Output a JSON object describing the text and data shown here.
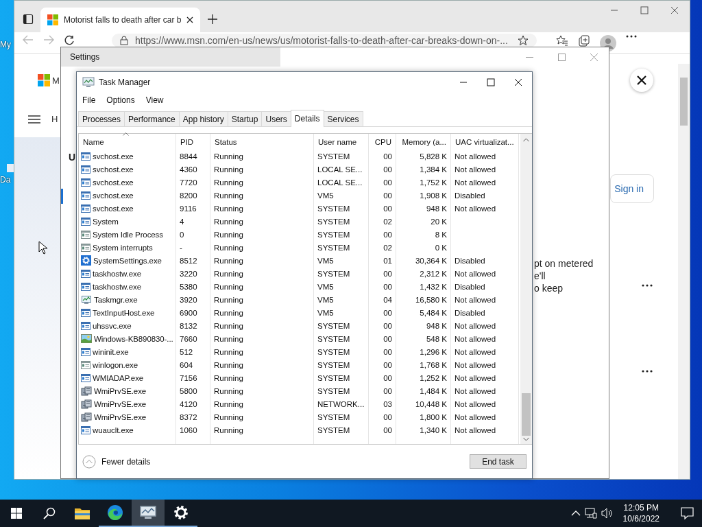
{
  "desktop": {
    "icons": [
      {
        "label": "My"
      },
      {
        "label": "Da"
      }
    ]
  },
  "browser": {
    "tab_title": "Motorist falls to death after car b",
    "address": "https://www.msn.com/en-us/news/us/motorist-falls-to-death-after-car-breaks-down-on-...",
    "page": {
      "logo_text": "M",
      "nav_text": "H",
      "sign_in": "Sign in"
    }
  },
  "settings": {
    "title": "Settings",
    "heading_fragment": "U",
    "text_lines": [
      "pt on metered",
      "e'll",
      "o keep"
    ]
  },
  "task_manager": {
    "title": "Task Manager",
    "menu": [
      "File",
      "Options",
      "View"
    ],
    "tabs": [
      {
        "label": "Processes",
        "selected": false
      },
      {
        "label": "Performance",
        "selected": false
      },
      {
        "label": "App history",
        "selected": false
      },
      {
        "label": "Startup",
        "selected": false
      },
      {
        "label": "Users",
        "selected": false
      },
      {
        "label": "Details",
        "selected": true
      },
      {
        "label": "Services",
        "selected": false
      }
    ],
    "columns": [
      {
        "label": "Name",
        "sorted": true
      },
      {
        "label": "PID",
        "sorted": false
      },
      {
        "label": "Status",
        "sorted": false
      },
      {
        "label": "User name",
        "sorted": false
      },
      {
        "label": "CPU",
        "sorted": false
      },
      {
        "label": "Memory (a...",
        "sorted": false
      },
      {
        "label": "UAC virtualizat...",
        "sorted": false
      }
    ],
    "rows": [
      {
        "kind": "service",
        "cells": [
          "svchost.exe",
          "8844",
          "Running",
          "SYSTEM",
          "00",
          "5,828 K",
          "Not allowed"
        ]
      },
      {
        "kind": "service",
        "cells": [
          "svchost.exe",
          "4360",
          "Running",
          "LOCAL SE...",
          "00",
          "1,384 K",
          "Not allowed"
        ]
      },
      {
        "kind": "service",
        "cells": [
          "svchost.exe",
          "7720",
          "Running",
          "LOCAL SE...",
          "00",
          "1,752 K",
          "Not allowed"
        ]
      },
      {
        "kind": "service",
        "cells": [
          "svchost.exe",
          "8200",
          "Running",
          "VM5",
          "00",
          "1,908 K",
          "Disabled"
        ]
      },
      {
        "kind": "service",
        "cells": [
          "svchost.exe",
          "9116",
          "Running",
          "SYSTEM",
          "00",
          "948 K",
          "Not allowed"
        ]
      },
      {
        "kind": "service",
        "cells": [
          "System",
          "4",
          "Running",
          "SYSTEM",
          "02",
          "20 K",
          ""
        ]
      },
      {
        "kind": "system",
        "cells": [
          "System Idle Process",
          "0",
          "Running",
          "SYSTEM",
          "00",
          "8 K",
          ""
        ]
      },
      {
        "kind": "system",
        "cells": [
          "System interrupts",
          "-",
          "Running",
          "SYSTEM",
          "02",
          "0 K",
          ""
        ]
      },
      {
        "kind": "settings",
        "cells": [
          "SystemSettings.exe",
          "8512",
          "Running",
          "VM5",
          "01",
          "30,364 K",
          "Disabled"
        ]
      },
      {
        "kind": "service",
        "cells": [
          "taskhostw.exe",
          "3220",
          "Running",
          "SYSTEM",
          "00",
          "2,312 K",
          "Not allowed"
        ]
      },
      {
        "kind": "service",
        "cells": [
          "taskhostw.exe",
          "5380",
          "Running",
          "VM5",
          "00",
          "1,432 K",
          "Disabled"
        ]
      },
      {
        "kind": "monitor",
        "cells": [
          "Taskmgr.exe",
          "3920",
          "Running",
          "VM5",
          "04",
          "16,580 K",
          "Not allowed"
        ]
      },
      {
        "kind": "service",
        "cells": [
          "TextInputHost.exe",
          "6900",
          "Running",
          "VM5",
          "00",
          "5,484 K",
          "Disabled"
        ]
      },
      {
        "kind": "service",
        "cells": [
          "uhssvc.exe",
          "8132",
          "Running",
          "SYSTEM",
          "00",
          "948 K",
          "Not allowed"
        ]
      },
      {
        "kind": "installer",
        "cells": [
          "Windows-KB890830-...",
          "7660",
          "Running",
          "SYSTEM",
          "00",
          "548 K",
          "Not allowed"
        ]
      },
      {
        "kind": "service",
        "cells": [
          "wininit.exe",
          "512",
          "Running",
          "SYSTEM",
          "00",
          "1,296 K",
          "Not allowed"
        ]
      },
      {
        "kind": "system",
        "cells": [
          "winlogon.exe",
          "604",
          "Running",
          "SYSTEM",
          "00",
          "1,768 K",
          "Not allowed"
        ]
      },
      {
        "kind": "service",
        "cells": [
          "WMIADAP.exe",
          "7156",
          "Running",
          "SYSTEM",
          "00",
          "1,252 K",
          "Not allowed"
        ]
      },
      {
        "kind": "provider",
        "cells": [
          "WmiPrvSE.exe",
          "5800",
          "Running",
          "SYSTEM",
          "00",
          "1,484 K",
          "Not allowed"
        ]
      },
      {
        "kind": "provider",
        "cells": [
          "WmiPrvSE.exe",
          "4120",
          "Running",
          "NETWORK...",
          "03",
          "10,448 K",
          "Not allowed"
        ]
      },
      {
        "kind": "provider",
        "cells": [
          "WmiPrvSE.exe",
          "8372",
          "Running",
          "SYSTEM",
          "00",
          "1,800 K",
          "Not allowed"
        ]
      },
      {
        "kind": "service",
        "cells": [
          "wuauclt.exe",
          "1060",
          "Running",
          "SYSTEM",
          "00",
          "1,340 K",
          "Not allowed"
        ]
      }
    ],
    "fewer_details": "Fewer details",
    "end_task": "End task"
  },
  "taskbar": {
    "apps": [
      {
        "kind": "explorer",
        "running": false,
        "active": false
      },
      {
        "kind": "edge",
        "running": true,
        "active": false
      },
      {
        "kind": "taskmgr",
        "running": true,
        "active": true
      },
      {
        "kind": "settings",
        "running": true,
        "active": false
      }
    ],
    "time": "12:05 PM",
    "date": "10/6/2022"
  }
}
